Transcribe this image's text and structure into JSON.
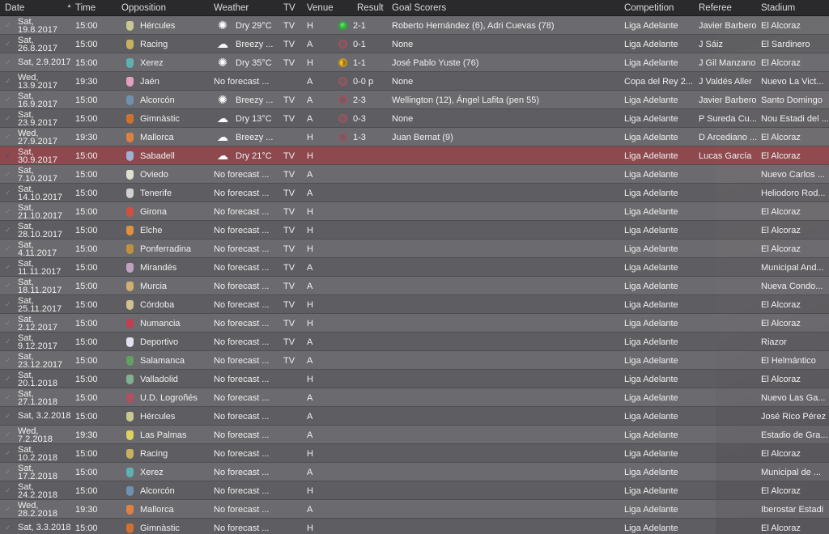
{
  "colors": {
    "header_bg": "#2a2a2c",
    "row_bg": "#6e6e72",
    "row_alt_bg": "#5f5f63",
    "current_row_bg": "#96464b",
    "win": "#22aa33",
    "draw": "#e0b020",
    "loss": "#a05060"
  },
  "columns": {
    "date": "Date",
    "time": "Time",
    "opposition": "Opposition",
    "weather": "Weather",
    "tv": "TV",
    "venue": "Venue",
    "result": "Result",
    "scorers": "Goal Scorers",
    "competition": "Competition",
    "referee": "Referee",
    "stadium": "Stadium"
  },
  "fixtures": [
    {
      "day": "Sat,",
      "date": "19.8.2017",
      "time": "15:00",
      "badge": "#c8c890",
      "opp": "Hércules",
      "wicon": "sun-icon",
      "weather": "Dry 29°C",
      "tv": "TV",
      "venue": "H",
      "rtype": "win",
      "result": "2-1",
      "scorers": "Roberto Hernández (6), Adri Cuevas (78)",
      "comp": "Liga Adelante",
      "ref": "Javier Barbero",
      "stadium": "El Alcoraz"
    },
    {
      "day": "Sat,",
      "date": "26.8.2017",
      "time": "15:00",
      "badge": "#c8b060",
      "opp": "Racing",
      "wicon": "cloud-icon",
      "weather": "Breezy ...",
      "tv": "TV",
      "venue": "A",
      "rtype": "loss",
      "result": "0-1",
      "scorers": "None",
      "comp": "Liga Adelante",
      "ref": "J Sáiz",
      "stadium": "El Sardinero"
    },
    {
      "day": "Sat, 2.9.2017",
      "date": "",
      "time": "15:00",
      "badge": "#60b0b0",
      "opp": "Xerez",
      "wicon": "sun-icon",
      "weather": "Dry 35°C",
      "tv": "TV",
      "venue": "H",
      "rtype": "draw",
      "result": "1-1",
      "scorers": "José Pablo Yuste (76)",
      "comp": "Liga Adelante",
      "ref": "J Gil Manzano",
      "stadium": "El Alcoraz"
    },
    {
      "day": "Wed,",
      "date": "13.9.2017",
      "time": "19:30",
      "badge": "#e0a0c0",
      "opp": "Jaén",
      "wicon": "",
      "weather": "No forecast ...",
      "tv": "",
      "venue": "A",
      "rtype": "loss",
      "result": "0-0 p",
      "scorers": "None",
      "comp": "Copa del Rey 2...",
      "ref": "J Valdés Aller",
      "stadium": "Nuevo La Vict..."
    },
    {
      "day": "Sat,",
      "date": "16.9.2017",
      "time": "15:00",
      "badge": "#7090b0",
      "opp": "Alcorcón",
      "wicon": "sun-icon",
      "weather": "Breezy ...",
      "tv": "TV",
      "venue": "A",
      "rtype": "loss",
      "result": "2-3",
      "scorers": "Wellington (12), Ángel Lafita (pen 55)",
      "comp": "Liga Adelante",
      "ref": "Javier Barbero",
      "stadium": "Santo Domingo"
    },
    {
      "day": "Sat,",
      "date": "23.9.2017",
      "time": "15:00",
      "badge": "#d07030",
      "opp": "Gimnàstic",
      "wicon": "cloud-icon",
      "weather": "Dry 13°C",
      "tv": "TV",
      "venue": "A",
      "rtype": "loss",
      "result": "0-3",
      "scorers": "None",
      "comp": "Liga Adelante",
      "ref": "P Sureda Cu...",
      "stadium": "Nou Estadi del ..."
    },
    {
      "day": "Wed,",
      "date": "27.9.2017",
      "time": "19:30",
      "badge": "#e08040",
      "opp": "Mallorca",
      "wicon": "cloud-icon",
      "weather": "Breezy ...",
      "tv": "",
      "venue": "H",
      "rtype": "loss",
      "result": "1-3",
      "scorers": "Juan Bernat (9)",
      "comp": "Liga Adelante",
      "ref": "D Arcediano ...",
      "stadium": "El Alcoraz"
    },
    {
      "day": "Sat,",
      "date": "30.9.2017",
      "time": "15:00",
      "badge": "#a0b0d0",
      "opp": "Sabadell",
      "wicon": "cloud-icon",
      "weather": "Dry 21°C",
      "tv": "TV",
      "venue": "H",
      "rtype": "",
      "result": "",
      "scorers": "",
      "comp": "Liga Adelante",
      "ref": "Lucas García",
      "stadium": "El Alcoraz",
      "current": true
    },
    {
      "day": "Sat,",
      "date": "7.10.2017",
      "time": "15:00",
      "badge": "#e0e0d0",
      "opp": "Oviedo",
      "wicon": "",
      "weather": "No forecast ...",
      "tv": "TV",
      "venue": "A",
      "rtype": "",
      "result": "",
      "scorers": "",
      "comp": "Liga Adelante",
      "ref": "",
      "stadium": "Nuevo Carlos ..."
    },
    {
      "day": "Sat,",
      "date": "14.10.2017",
      "time": "15:00",
      "badge": "#d0d0d0",
      "opp": "Tenerife",
      "wicon": "",
      "weather": "No forecast ...",
      "tv": "TV",
      "venue": "A",
      "rtype": "",
      "result": "",
      "scorers": "",
      "comp": "Liga Adelante",
      "ref": "",
      "stadium": "Heliodoro Rod..."
    },
    {
      "day": "Sat,",
      "date": "21.10.2017",
      "time": "15:00",
      "badge": "#d05040",
      "opp": "Girona",
      "wicon": "",
      "weather": "No forecast ...",
      "tv": "TV",
      "venue": "H",
      "rtype": "",
      "result": "",
      "scorers": "",
      "comp": "Liga Adelante",
      "ref": "",
      "stadium": "El Alcoraz"
    },
    {
      "day": "Sat,",
      "date": "28.10.2017",
      "time": "15:00",
      "badge": "#e09040",
      "opp": "Elche",
      "wicon": "",
      "weather": "No forecast ...",
      "tv": "TV",
      "venue": "H",
      "rtype": "",
      "result": "",
      "scorers": "",
      "comp": "Liga Adelante",
      "ref": "",
      "stadium": "El Alcoraz"
    },
    {
      "day": "Sat,",
      "date": "4.11.2017",
      "time": "15:00",
      "badge": "#c09040",
      "opp": "Ponferradina",
      "wicon": "",
      "weather": "No forecast ...",
      "tv": "TV",
      "venue": "H",
      "rtype": "",
      "result": "",
      "scorers": "",
      "comp": "Liga Adelante",
      "ref": "",
      "stadium": "El Alcoraz"
    },
    {
      "day": "Sat,",
      "date": "11.11.2017",
      "time": "15:00",
      "badge": "#c0a0c0",
      "opp": "Mirandés",
      "wicon": "",
      "weather": "No forecast ...",
      "tv": "TV",
      "venue": "A",
      "rtype": "",
      "result": "",
      "scorers": "",
      "comp": "Liga Adelante",
      "ref": "",
      "stadium": "Municipal And..."
    },
    {
      "day": "Sat,",
      "date": "18.11.2017",
      "time": "15:00",
      "badge": "#d0b070",
      "opp": "Murcia",
      "wicon": "",
      "weather": "No forecast ...",
      "tv": "TV",
      "venue": "A",
      "rtype": "",
      "result": "",
      "scorers": "",
      "comp": "Liga Adelante",
      "ref": "",
      "stadium": "Nueva Condo..."
    },
    {
      "day": "Sat,",
      "date": "25.11.2017",
      "time": "15:00",
      "badge": "#d0c090",
      "opp": "Córdoba",
      "wicon": "",
      "weather": "No forecast ...",
      "tv": "TV",
      "venue": "H",
      "rtype": "",
      "result": "",
      "scorers": "",
      "comp": "Liga Adelante",
      "ref": "",
      "stadium": "El Alcoraz"
    },
    {
      "day": "Sat,",
      "date": "2.12.2017",
      "time": "15:00",
      "badge": "#c04050",
      "opp": "Numancia",
      "wicon": "",
      "weather": "No forecast ...",
      "tv": "TV",
      "venue": "H",
      "rtype": "",
      "result": "",
      "scorers": "",
      "comp": "Liga Adelante",
      "ref": "",
      "stadium": "El Alcoraz"
    },
    {
      "day": "Sat,",
      "date": "9.12.2017",
      "time": "15:00",
      "badge": "#e0e0f0",
      "opp": "Deportivo",
      "wicon": "",
      "weather": "No forecast ...",
      "tv": "TV",
      "venue": "A",
      "rtype": "",
      "result": "",
      "scorers": "",
      "comp": "Liga Adelante",
      "ref": "",
      "stadium": "Riazor"
    },
    {
      "day": "Sat,",
      "date": "23.12.2017",
      "time": "15:00",
      "badge": "#60a060",
      "opp": "Salamanca",
      "wicon": "",
      "weather": "No forecast ...",
      "tv": "TV",
      "venue": "A",
      "rtype": "",
      "result": "",
      "scorers": "",
      "comp": "Liga Adelante",
      "ref": "",
      "stadium": "El Helmántico"
    },
    {
      "day": "Sat,",
      "date": "20.1.2018",
      "time": "15:00",
      "badge": "#80b090",
      "opp": "Valladolid",
      "wicon": "",
      "weather": "No forecast ...",
      "tv": "",
      "venue": "H",
      "rtype": "",
      "result": "",
      "scorers": "",
      "comp": "Liga Adelante",
      "ref": "",
      "stadium": "El Alcoraz"
    },
    {
      "day": "Sat,",
      "date": "27.1.2018",
      "time": "15:00",
      "badge": "#b05060",
      "opp": "U.D. Logroñés",
      "wicon": "",
      "weather": "No forecast ...",
      "tv": "",
      "venue": "A",
      "rtype": "",
      "result": "",
      "scorers": "",
      "comp": "Liga Adelante",
      "ref": "",
      "stadium": "Nuevo Las Ga..."
    },
    {
      "day": "Sat, 3.2.2018",
      "date": "",
      "time": "15:00",
      "badge": "#c8c890",
      "opp": "Hércules",
      "wicon": "",
      "weather": "No forecast ...",
      "tv": "",
      "venue": "A",
      "rtype": "",
      "result": "",
      "scorers": "",
      "comp": "Liga Adelante",
      "ref": "",
      "stadium": "José Rico Pérez"
    },
    {
      "day": "Wed,",
      "date": "7.2.2018",
      "time": "19:30",
      "badge": "#e0d060",
      "opp": "Las Palmas",
      "wicon": "",
      "weather": "No forecast ...",
      "tv": "",
      "venue": "A",
      "rtype": "",
      "result": "",
      "scorers": "",
      "comp": "Liga Adelante",
      "ref": "",
      "stadium": "Estadio de Gra..."
    },
    {
      "day": "Sat,",
      "date": "10.2.2018",
      "time": "15:00",
      "badge": "#c8b060",
      "opp": "Racing",
      "wicon": "",
      "weather": "No forecast ...",
      "tv": "",
      "venue": "H",
      "rtype": "",
      "result": "",
      "scorers": "",
      "comp": "Liga Adelante",
      "ref": "",
      "stadium": "El Alcoraz"
    },
    {
      "day": "Sat,",
      "date": "17.2.2018",
      "time": "15:00",
      "badge": "#60b0b0",
      "opp": "Xerez",
      "wicon": "",
      "weather": "No forecast ...",
      "tv": "",
      "venue": "A",
      "rtype": "",
      "result": "",
      "scorers": "",
      "comp": "Liga Adelante",
      "ref": "",
      "stadium": "Municipal de ..."
    },
    {
      "day": "Sat,",
      "date": "24.2.2018",
      "time": "15:00",
      "badge": "#7090b0",
      "opp": "Alcorcón",
      "wicon": "",
      "weather": "No forecast ...",
      "tv": "",
      "venue": "H",
      "rtype": "",
      "result": "",
      "scorers": "",
      "comp": "Liga Adelante",
      "ref": "",
      "stadium": "El Alcoraz"
    },
    {
      "day": "Wed,",
      "date": "28.2.2018",
      "time": "19:30",
      "badge": "#e08040",
      "opp": "Mallorca",
      "wicon": "",
      "weather": "No forecast ...",
      "tv": "",
      "venue": "A",
      "rtype": "",
      "result": "",
      "scorers": "",
      "comp": "Liga Adelante",
      "ref": "",
      "stadium": "Iberostar Estadi"
    },
    {
      "day": "Sat, 3.3.2018",
      "date": "",
      "time": "15:00",
      "badge": "#d07030",
      "opp": "Gimnàstic",
      "wicon": "",
      "weather": "No forecast ...",
      "tv": "",
      "venue": "H",
      "rtype": "",
      "result": "",
      "scorers": "",
      "comp": "Liga Adelante",
      "ref": "",
      "stadium": "El Alcoraz"
    }
  ]
}
